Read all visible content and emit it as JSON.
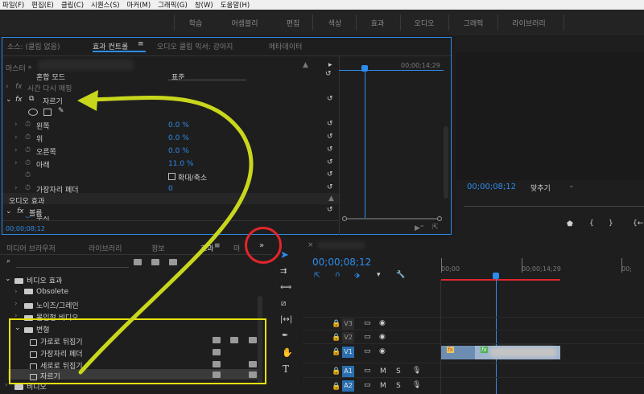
{
  "menubar": {
    "items": [
      "파일(F)",
      "편집(E)",
      "클립(C)",
      "시퀀스(S)",
      "마커(M)",
      "그래픽(G)",
      "창(W)",
      "도움말(H)"
    ]
  },
  "workspaces": [
    "학습",
    "어셈블리",
    "편집",
    "색상",
    "효과",
    "오디오",
    "그래픽",
    "라이브러리"
  ],
  "ec": {
    "tab_source": "소스: (클립 없음)",
    "tab_effects": "효과 컨트롤",
    "tab_audio_mixer": "오디오 클립 믹서: 강아지",
    "tab_metadata": "메타데이터",
    "master_label": "마스터 *",
    "timecode_ruler": "00;00;14;29",
    "blend_mode_label": "혼합 모드",
    "blend_mode_value": "표준",
    "time_remap": "시간 다시 매핑",
    "crop_effect": "자르기",
    "params": [
      {
        "label": "왼쪽",
        "value": "0.0",
        "unit": "%"
      },
      {
        "label": "위",
        "value": "0.0",
        "unit": "%"
      },
      {
        "label": "오른쪽",
        "value": "0.0",
        "unit": "%"
      },
      {
        "label": "아래",
        "value": "11.0",
        "unit": "%"
      }
    ],
    "zoom_label": "확대/축소",
    "feather_label": "가장자리 페더",
    "feather_value": "0",
    "audio_effects": "오디오 효과",
    "volume": "볼륨",
    "bypass": "무시",
    "current_time": "00;00;08;12"
  },
  "program": {
    "timecode": "00;00;08;12",
    "fit": "맞추기"
  },
  "project": {
    "tabs": [
      "미디어 브라우저",
      "라이브러리",
      "정보",
      "효과",
      "마"
    ],
    "more": "»",
    "tree": [
      {
        "label": "비디오 효과"
      },
      {
        "label": "Obsolete"
      },
      {
        "label": "노이즈/그레인"
      },
      {
        "label": "몰입형 비디오"
      },
      {
        "label": "변형"
      },
      {
        "label": "가로로 뒤집기"
      },
      {
        "label": "가장자리 페더"
      },
      {
        "label": "세로로 뒤집기"
      },
      {
        "label": "자르기"
      },
      {
        "label": "비디오"
      }
    ]
  },
  "timeline": {
    "timecode": "00;00;08;12",
    "ruler": [
      "00;00",
      "00;00;14;29",
      "00;"
    ],
    "video_tracks": [
      "V3",
      "V2",
      "V1"
    ],
    "audio_tracks": [
      "A1",
      "A2"
    ],
    "m": "M",
    "s": "S",
    "clip_fx": "fx"
  },
  "colors": {
    "accent": "#2d8ceb",
    "highlight_yellow": "#e4e10e",
    "annotation_red": "#e0262b",
    "arrow_green": "#c8d71c"
  }
}
